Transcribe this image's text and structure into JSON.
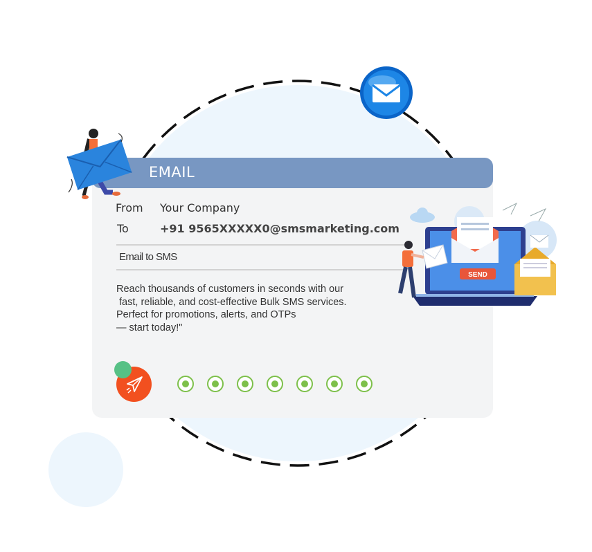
{
  "header": {
    "title": "EMAIL"
  },
  "from": {
    "label": "From",
    "value": "Your Company"
  },
  "to": {
    "label": "To",
    "value": "+91 9565XXXXX0@smsmarketing.com"
  },
  "subject": "Email to SMS",
  "body_lines": [
    "Reach thousands of customers in seconds with our",
    " fast, reliable, and cost-effective Bulk SMS services.",
    "Perfect for promotions, alerts, and OTPs",
    "— start today!\""
  ],
  "send_label": "SEND",
  "icons": [
    "mail-globe-icon",
    "paper-plane-icon",
    "cloud-icon",
    "laptop-icon"
  ],
  "progress_dots": 7,
  "colors": {
    "header": "#7897c2",
    "send": "#f2501f",
    "dot": "#7dc04a",
    "accent_green": "#57c186"
  }
}
